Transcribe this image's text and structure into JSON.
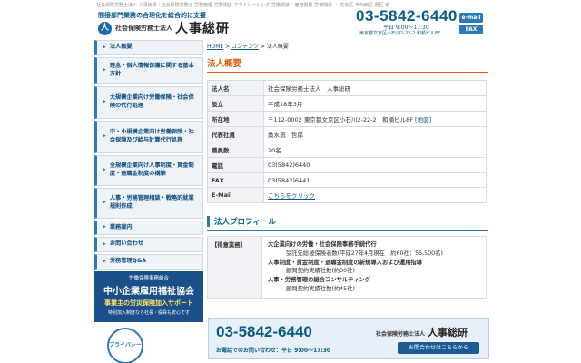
{
  "header": {
    "topline": "社会保険労務士法人 人事総研｜社会保険労務士 労務管理 労務相談 アウトソーシング 労働相談 ･ 雇用問題 労使関係 ・ 文京区 千代田区 港区 他",
    "tagline": "間接部門業務の合理化を総合的に支援",
    "logo_mark": "人",
    "logo_sub": "社会保険労務士法人",
    "logo_name": "人事総研",
    "phone": "03-5842-6440",
    "hours": "平日 9:00～17:30",
    "address": "東京都文京区小石川2-22-2 和順ビル8F",
    "email_label": "e-mail",
    "fax_label": "FAX"
  },
  "sidebar": {
    "items": [
      {
        "label": "法人概要"
      },
      {
        "label": "理念・個人情報保護に関する基本方針"
      },
      {
        "label": "大規模企業向け労働保険・社会保険の代行処理"
      },
      {
        "label": "中・小規模企業向け労働保険・社会保険及び給与計算代行処理"
      },
      {
        "label": "全規模企業向け人事制度・賃金制度・退職金制度の構築"
      },
      {
        "label": "人事・労務管理相談・戦略的就業規則作成"
      },
      {
        "label": "業務案内"
      },
      {
        "label": "お問い合わせ"
      },
      {
        "label": "労務管理Q&A"
      }
    ],
    "banner": {
      "line1": "労働保険事務組合",
      "line2": "中小企業雇用福祉協会",
      "line3": "事業主の労災保険加入サポート",
      "line4": "特別加入制度なら社長・役員も安心です"
    },
    "privacy_label": "プライバシー"
  },
  "main": {
    "breadcrumb": {
      "home": "HOME",
      "sep1": " > ",
      "contents": "コンテンツ",
      "sep2": " > ",
      "current": "法人概要"
    },
    "title": "法人概要",
    "table": {
      "rows": [
        {
          "label": "法人名",
          "value": "社会保険労務士法人　人事総研"
        },
        {
          "label": "設立",
          "value": "平成18年3月"
        },
        {
          "label": "所在地",
          "value": "〒112-0002 東京都文京区小石川2-22-2　和順ビル8F",
          "link": "[地図]"
        },
        {
          "label": "代表社員",
          "value": "桑水流　哲郎"
        },
        {
          "label": "職員数",
          "value": "20名"
        },
        {
          "label": "電話",
          "value": "03(5842)6440"
        },
        {
          "label": "FAX",
          "value": "03(5842)6441"
        },
        {
          "label": "E-Mail",
          "value": "こちらをクリック"
        }
      ]
    },
    "profile": {
      "title": "法人プロフィール",
      "label": "【得意業務】",
      "lines": [
        "大企業向けの労働・社会保険事務手続代行",
        "受託先総被保険者数(平成27年4月現在　約60社：55,500名)",
        "人事制度・賃金制度・退職金制度の新規導入および運用指導",
        "顧問契約実績社数(約30社)",
        "人事・労務管理の総合コンサルティング",
        "顧問契約実績社数(約45社)"
      ]
    }
  },
  "footer": {
    "phone": "03-5842-6440",
    "hours": "お電話でのお問い合わせ：平日 9:00～17:30",
    "logo_sub": "社会保険労務士法人",
    "logo_name": "人事総研",
    "contact_label": "お問合わせはこちらから"
  },
  "colors": {
    "accent": "#0a5c86",
    "title_orange": "#e05a0a",
    "sidebar_bg": "#eef3f8",
    "banner_bg": "#1b4f8a"
  }
}
